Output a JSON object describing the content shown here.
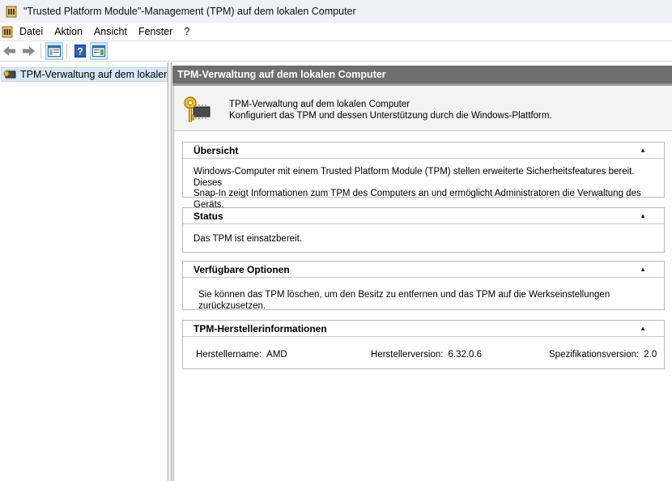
{
  "window": {
    "title": "\"Trusted Platform Module\"-Management (TPM) auf dem lokalen Computer",
    "icon": "tpm-key-icon"
  },
  "menu": {
    "items": [
      "Datei",
      "Aktion",
      "Ansicht",
      "Fenster",
      "?"
    ]
  },
  "toolbar": {
    "buttons": [
      "back-icon",
      "forward-icon",
      "show-console-tree-icon",
      "help-icon",
      "show-action-pane-icon"
    ]
  },
  "tree": {
    "selected_item": "TPM-Verwaltung auf dem lokalen Computer"
  },
  "main": {
    "header": "TPM-Verwaltung auf dem lokalen Computer",
    "banner_title": "TPM-Verwaltung auf dem lokalen Computer",
    "banner_desc": "Konfiguriert das TPM und dessen Unterstützung durch die Windows-Plattform.",
    "overview": {
      "title": "Übersicht",
      "line1": "Windows-Computer mit einem Trusted Platform Module (TPM) stellen erweiterte Sicherheitsfeatures bereit. Dieses",
      "line2": "Snap-In zeigt Informationen zum TPM des Computers an und ermöglicht Administratoren die Verwaltung des Geräts."
    },
    "status": {
      "title": "Status",
      "text": "Das TPM ist einsatzbereit."
    },
    "options": {
      "title": "Verfügbare Optionen",
      "text": "Sie können das TPM löschen, um den Besitz zu entfernen und das TPM auf die Werkseinstellungen zurückzusetzen."
    },
    "manufacturer": {
      "title": "TPM-Herstellerinformationen",
      "name_label": "Herstellername:",
      "name_value": "AMD",
      "version_label": "Herstellerversion:",
      "version_value": "6.32.0.6",
      "spec_label": "Spezifikationsversion:",
      "spec_value": "2.0"
    }
  },
  "colors": {
    "header_bg": "#6e6e6e",
    "selection_bg": "#d9e8f6",
    "banner_bg": "#f3f3f3"
  }
}
